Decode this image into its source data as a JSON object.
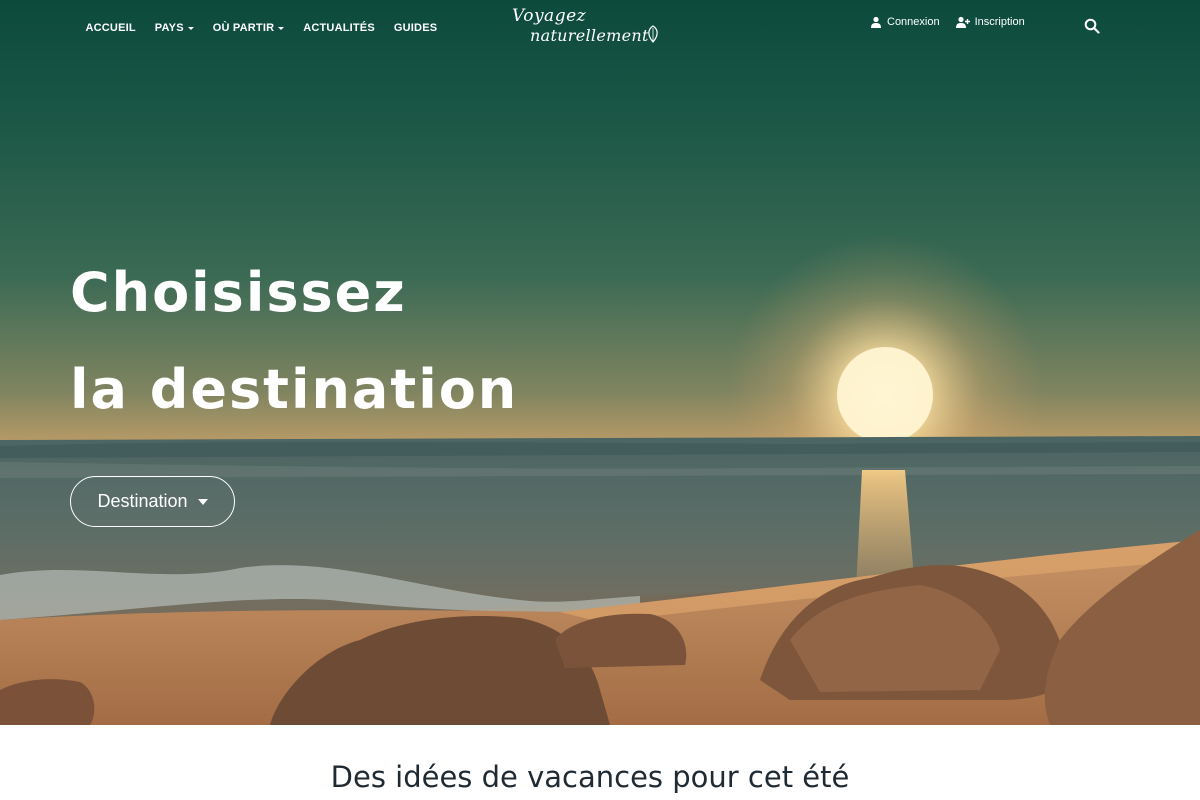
{
  "nav": {
    "items": [
      {
        "label": "ACCUEIL",
        "dropdown": false
      },
      {
        "label": "PAYS",
        "dropdown": true
      },
      {
        "label": "OÙ PARTIR",
        "dropdown": true
      },
      {
        "label": "ACTUALITÉS",
        "dropdown": false
      },
      {
        "label": "GUIDES",
        "dropdown": false
      }
    ],
    "logo_line1": "Voyagez",
    "logo_line2": "naturellement",
    "login_label": "Connexion",
    "signup_label": "Inscription",
    "search_icon": "search-icon"
  },
  "hero": {
    "headline_line1": "Choisissez",
    "headline_line2": "la destination",
    "destination_button": "Destination"
  },
  "section": {
    "title": "Des idées de vacances pour cet été"
  },
  "colors": {
    "sky_top": "#0c4a3c",
    "sun": "#fff1c8",
    "text_dark": "#1f2a33"
  }
}
